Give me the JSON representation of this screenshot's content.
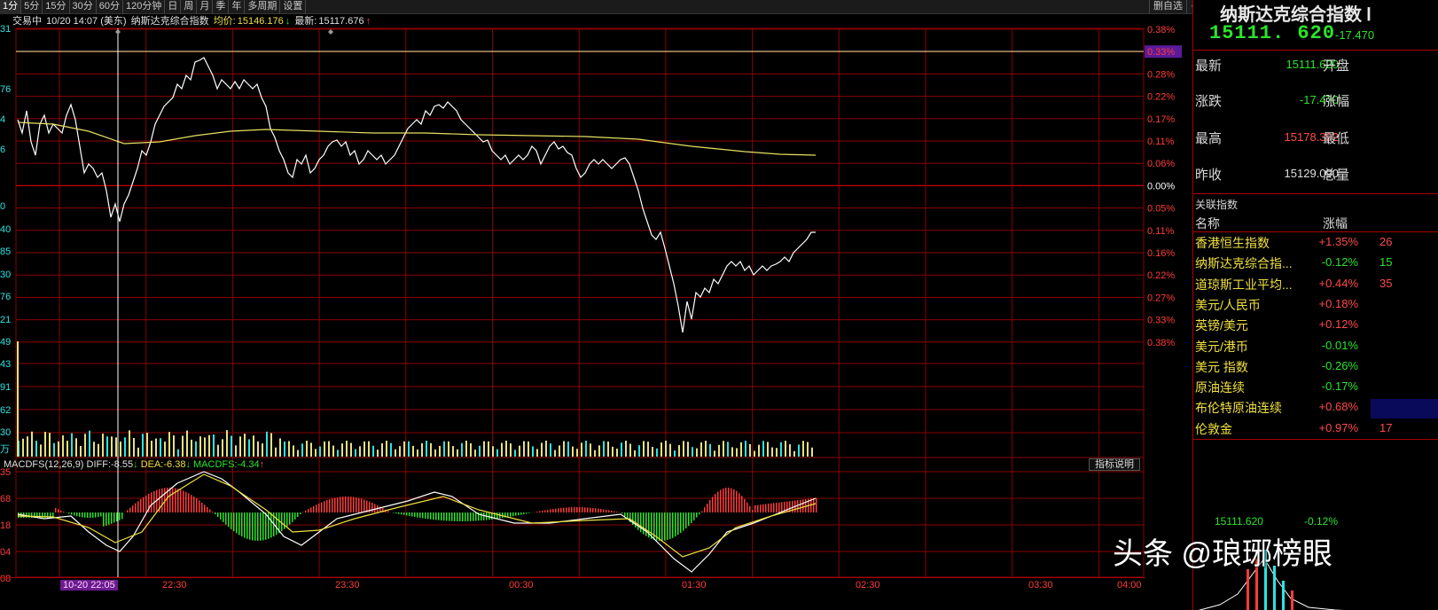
{
  "toolbar": {
    "periods": [
      "1分",
      "5分",
      "15分",
      "30分",
      "60分",
      "120分钟",
      "日",
      "周",
      "月",
      "季",
      "年",
      "多周期",
      "设置"
    ],
    "active_period": "1分",
    "custom_label": "删自选",
    "add_symbol": "+",
    "minus_symbol": "−",
    "restore_symbol": "⧉"
  },
  "info": {
    "status": "交易中",
    "datetime": "10/20 14:07 (美东)",
    "index_name": "纳斯达克综合指数",
    "avg_label": "均价:",
    "avg_value": "15146.176",
    "avg_arrow": "↓",
    "last_label": "最新:",
    "last_value": "15117.676",
    "last_arrow": "↑"
  },
  "left_axis": {
    "labels": [
      "31",
      "76",
      "4",
      "6",
      "0",
      "40",
      "85",
      "30",
      "76",
      "21",
      "49",
      "43",
      "91",
      "62",
      "30",
      "万"
    ],
    "macd_labels": [
      "35",
      "68",
      "18",
      "04",
      "08"
    ]
  },
  "right_axis": {
    "labels": [
      "0.38%",
      "0.33%",
      "0.28%",
      "0.22%",
      "0.17%",
      "0.11%",
      "0.06%",
      "0.00%",
      "0.05%",
      "0.11%",
      "0.16%",
      "0.22%",
      "0.27%",
      "0.33%",
      "0.38%"
    ]
  },
  "macd_header": {
    "title": "MACDFS(12,26,9)",
    "diff_label": "DIFF:",
    "diff_value": "-8.55",
    "diff_arrow": "↓",
    "dea_label": "DEA:",
    "dea_value": "-6.38",
    "dea_arrow": "↓",
    "macdfs_label": "MACDFS:",
    "macdfs_value": "-4.34",
    "macdfs_arrow": "↑",
    "indicator_button": "指标说明"
  },
  "time_axis": {
    "cursor_label": "10-20 22:05",
    "labels": [
      "22:30",
      "23:30",
      "00:30",
      "01:30",
      "02:30",
      "03:30",
      "04:00"
    ]
  },
  "quote_panel": {
    "title": "纳斯达克综合指数 Ⅰ",
    "price": "15111. 620",
    "change": "-17.470",
    "rows": [
      {
        "label": "最新",
        "value": "15111.620",
        "value_color": "#2ce32c",
        "label2": "开盘"
      },
      {
        "label": "涨跌",
        "value": "-17.470",
        "value_color": "#2ce32c",
        "label2": "涨幅"
      },
      {
        "label": "最高",
        "value": "15178.392",
        "value_color": "#ff4a4a",
        "label2": "最低"
      },
      {
        "label": "昨收",
        "value": "15129.090",
        "value_color": "#e0e0e0",
        "label2": "总量"
      }
    ],
    "related_title": "关联指数",
    "col_name": "名称",
    "col_change": "涨幅",
    "related": [
      {
        "name": "香港恒生指数",
        "change": "+1.35%",
        "color": "#ff4a4a",
        "extra": "26"
      },
      {
        "name": "纳斯达克综合指...",
        "change": "-0.12%",
        "color": "#2ce32c",
        "extra": "15"
      },
      {
        "name": "道琼斯工业平均...",
        "change": "+0.44%",
        "color": "#ff4a4a",
        "extra": "35"
      },
      {
        "name": "美元/人民币",
        "change": "+0.18%",
        "color": "#ff4a4a",
        "extra": ""
      },
      {
        "name": "英镑/美元",
        "change": "+0.12%",
        "color": "#ff4a4a",
        "extra": ""
      },
      {
        "name": "美元/港币",
        "change": "-0.01%",
        "color": "#2ce32c",
        "extra": ""
      },
      {
        "name": "美元 指数",
        "change": "-0.26%",
        "color": "#2ce32c",
        "extra": ""
      },
      {
        "name": "原油连续",
        "change": "-0.17%",
        "color": "#2ce32c",
        "extra": ""
      },
      {
        "name": "布伦特原油连续",
        "change": "+0.68%",
        "color": "#ff4a4a",
        "extra": ""
      },
      {
        "name": "伦敦金",
        "change": "+0.97%",
        "color": "#ff4a4a",
        "extra": "17"
      }
    ],
    "mini_price": "15111.620",
    "mini_change": "-0.12%"
  },
  "watermark": "头条 @琅琊榜眼",
  "colors": {
    "grid": "#8b0000",
    "price_line": "#ffffff",
    "avg_line": "#e8e060",
    "up": "#ff3b3b",
    "down": "#2ce32c",
    "volume": "#e8e080"
  }
}
